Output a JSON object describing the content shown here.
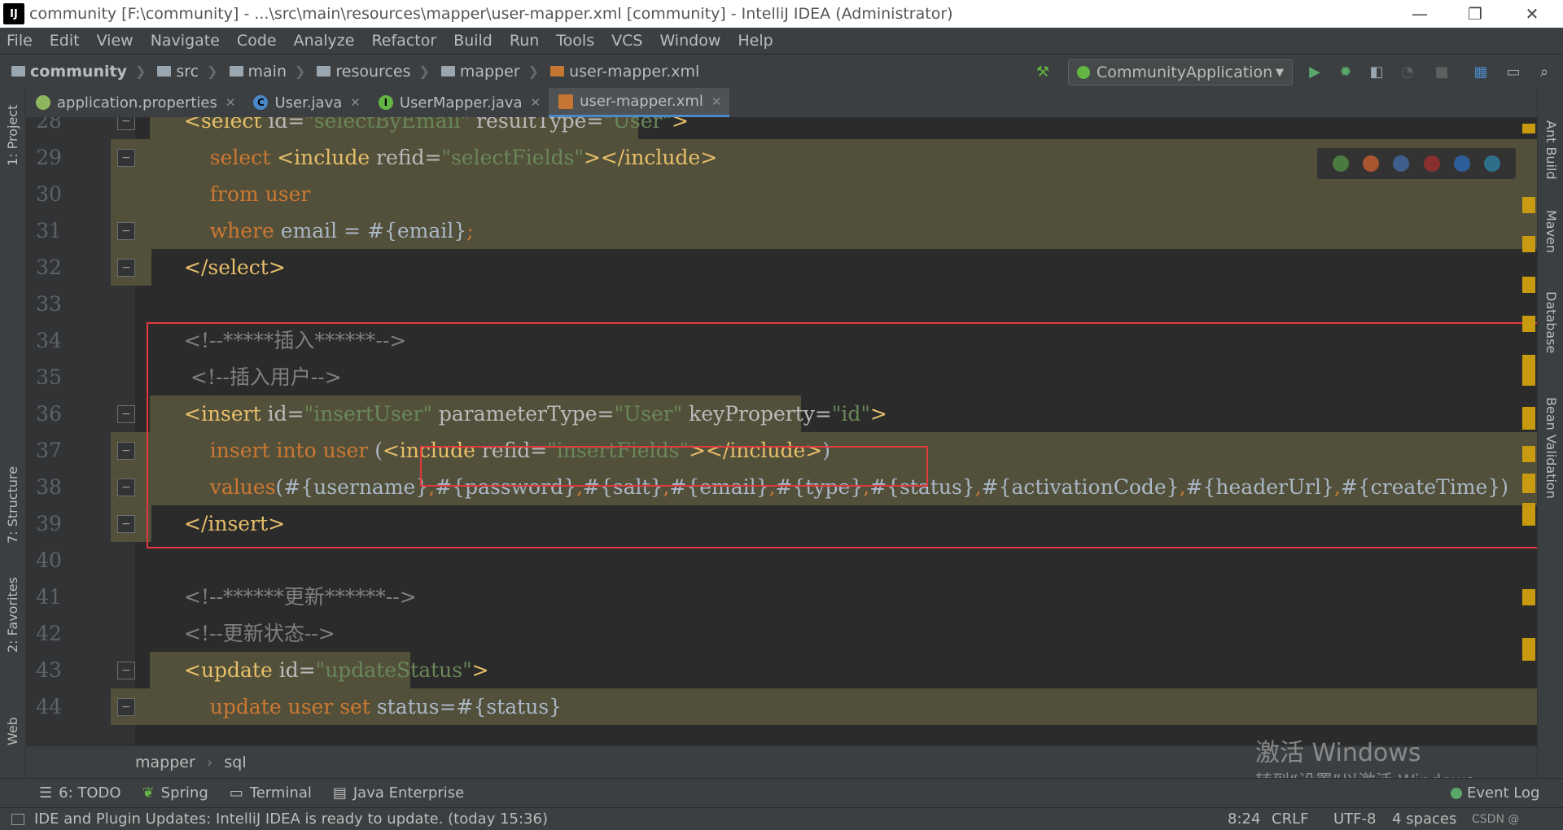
{
  "window": {
    "title": "community [F:\\community] - ...\\src\\main\\resources\\mapper\\user-mapper.xml [community] - IntelliJ IDEA (Administrator)",
    "minimize": "—",
    "restore": "❐",
    "close": "✕"
  },
  "menu": [
    "File",
    "Edit",
    "View",
    "Navigate",
    "Code",
    "Analyze",
    "Refactor",
    "Build",
    "Run",
    "Tools",
    "VCS",
    "Window",
    "Help"
  ],
  "breadcrumb": [
    "community",
    "src",
    "main",
    "resources",
    "mapper",
    "user-mapper.xml"
  ],
  "run_config": "CommunityApplication",
  "tabs": [
    {
      "label": "application.properties",
      "icon_color": "#8fb55e",
      "active": false
    },
    {
      "label": "User.java",
      "icon_color": "#4a88c7",
      "active": false
    },
    {
      "label": "UserMapper.java",
      "icon_color": "#62b543",
      "active": false
    },
    {
      "label": "user-mapper.xml",
      "icon_color": "#c57633",
      "active": true
    }
  ],
  "left_tools": [
    "1: Project",
    "7: Structure",
    "2: Favorites",
    "Web"
  ],
  "right_tools": [
    "Ant Build",
    "Maven",
    "Database",
    "Bean Validation"
  ],
  "code_lines": [
    {
      "n": "28",
      "parts": [
        [
          "tag",
          "<select "
        ],
        [
          "attr",
          "id="
        ],
        [
          "val",
          "\"selectByEmail\""
        ],
        [
          "attr",
          " resultType="
        ],
        [
          "val",
          "\"User\""
        ],
        [
          "tag",
          ">"
        ]
      ]
    },
    {
      "n": "29",
      "parts": [
        [
          "kw",
          "    select "
        ],
        [
          "tag",
          "<include "
        ],
        [
          "attr",
          "refid="
        ],
        [
          "val",
          "\"selectFields\""
        ],
        [
          "tag",
          "></include>"
        ]
      ]
    },
    {
      "n": "30",
      "parts": [
        [
          "kw",
          "    from user"
        ]
      ]
    },
    {
      "n": "31",
      "parts": [
        [
          "kw",
          "    where "
        ],
        [
          "plain",
          "email = #{email}"
        ],
        [
          "kw",
          ";"
        ]
      ]
    },
    {
      "n": "32",
      "parts": [
        [
          "tag",
          "</select>"
        ]
      ]
    },
    {
      "n": "33",
      "parts": []
    },
    {
      "n": "34",
      "parts": [
        [
          "cm",
          "<!--*****插入******-->"
        ]
      ]
    },
    {
      "n": "35",
      "parts": [
        [
          "cm",
          " <!--插入用户-->"
        ]
      ]
    },
    {
      "n": "36",
      "parts": [
        [
          "tag",
          "<insert "
        ],
        [
          "attr",
          "id="
        ],
        [
          "val",
          "\"insertUser\""
        ],
        [
          "attr",
          " parameterType="
        ],
        [
          "val",
          "\"User\""
        ],
        [
          "attr",
          " keyProperty="
        ],
        [
          "val",
          "\"id\""
        ],
        [
          "tag",
          ">"
        ]
      ]
    },
    {
      "n": "37",
      "parts": [
        [
          "kw",
          "    insert into user "
        ],
        [
          "plain",
          "("
        ],
        [
          "tag",
          "<include "
        ],
        [
          "attr",
          "refid="
        ],
        [
          "val",
          "\"insertFields\""
        ],
        [
          "tag",
          "></include>"
        ],
        [
          "plain",
          ")"
        ]
      ]
    },
    {
      "n": "38",
      "parts": [
        [
          "kw",
          "    values"
        ],
        [
          "plain",
          "(#{username}"
        ],
        [
          "kw",
          ","
        ],
        [
          "plain",
          "#{password}"
        ],
        [
          "kw",
          ","
        ],
        [
          "plain",
          "#{salt}"
        ],
        [
          "kw",
          ","
        ],
        [
          "plain",
          "#{email}"
        ],
        [
          "kw",
          ","
        ],
        [
          "plain",
          "#{type}"
        ],
        [
          "kw",
          ","
        ],
        [
          "plain",
          "#{status}"
        ],
        [
          "kw",
          ","
        ],
        [
          "plain",
          "#{activationCode}"
        ],
        [
          "kw",
          ","
        ],
        [
          "plain",
          "#{headerUrl}"
        ],
        [
          "kw",
          ","
        ],
        [
          "plain",
          "#{createTime})"
        ]
      ]
    },
    {
      "n": "39",
      "parts": [
        [
          "tag",
          "</insert>"
        ]
      ]
    },
    {
      "n": "40",
      "parts": []
    },
    {
      "n": "41",
      "parts": [
        [
          "cm",
          "<!--******更新******-->"
        ]
      ]
    },
    {
      "n": "42",
      "parts": [
        [
          "cm",
          "<!--更新状态-->"
        ]
      ]
    },
    {
      "n": "43",
      "parts": [
        [
          "tag",
          "<update "
        ],
        [
          "attr",
          "id="
        ],
        [
          "val",
          "\"updateStatus\""
        ],
        [
          "tag",
          ">"
        ]
      ]
    },
    {
      "n": "44",
      "parts": [
        [
          "kw",
          "    update user set "
        ],
        [
          "plain",
          "status=#{status}"
        ]
      ]
    }
  ],
  "editor_breadcrumb": [
    "mapper",
    "sql"
  ],
  "tool_windows": [
    "6: TODO",
    "Spring",
    "Terminal",
    "Java Enterprise"
  ],
  "event_log": "Event Log",
  "status": {
    "message": "IDE and Plugin Updates: IntelliJ IDEA is ready to update. (today 15:36)",
    "position": "8:24",
    "line_sep": "CRLF",
    "encoding": "UTF-8",
    "indent": "4 spaces"
  },
  "watermark": {
    "line1": "激活 Windows",
    "line2": "转到“设置”以激活 Windows。",
    "csdn": "CSDN @"
  },
  "colors": {
    "highlight": "#52503a",
    "red_box": "#e0393e",
    "tag": "#e8bf6a",
    "value": "#6a8759",
    "keyword": "#cc7832",
    "comment": "#808080"
  }
}
